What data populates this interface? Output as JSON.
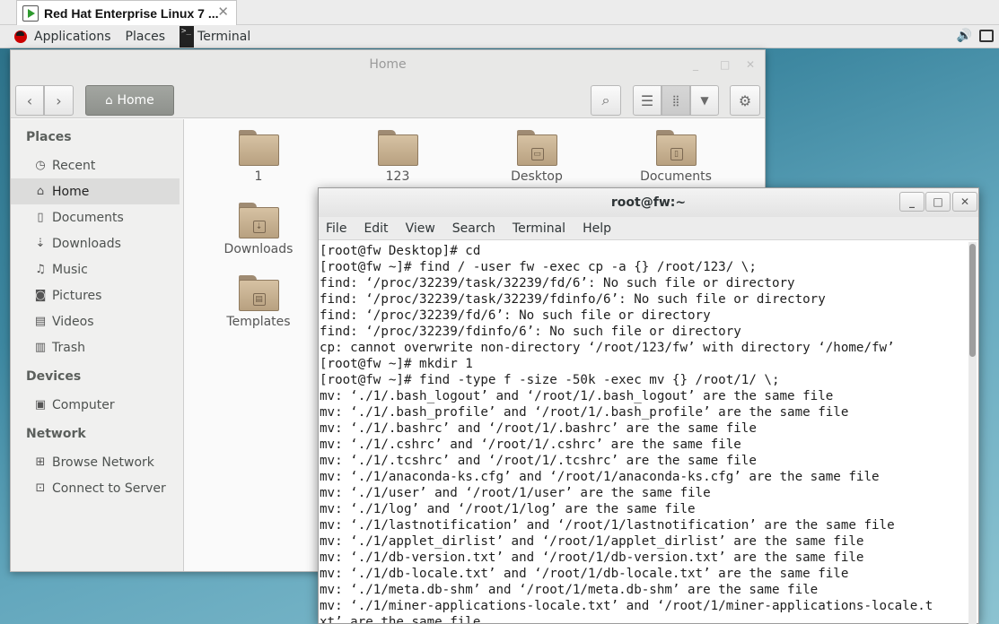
{
  "vm_tab": {
    "title": "Red Hat Enterprise Linux 7 ...",
    "close": "✕"
  },
  "topbar": {
    "applications": "Applications",
    "places": "Places",
    "terminal": "Terminal"
  },
  "files": {
    "title": "Home",
    "location": "Home",
    "sidebar": {
      "places_heading": "Places",
      "places": [
        {
          "label": "Recent",
          "icon": "clock-icon"
        },
        {
          "label": "Home",
          "icon": "home-icon"
        },
        {
          "label": "Documents",
          "icon": "document-icon"
        },
        {
          "label": "Downloads",
          "icon": "download-icon"
        },
        {
          "label": "Music",
          "icon": "music-icon"
        },
        {
          "label": "Pictures",
          "icon": "camera-icon"
        },
        {
          "label": "Videos",
          "icon": "film-icon"
        },
        {
          "label": "Trash",
          "icon": "trash-icon"
        }
      ],
      "devices_heading": "Devices",
      "devices": [
        {
          "label": "Computer",
          "icon": "drive-icon"
        }
      ],
      "network_heading": "Network",
      "network": [
        {
          "label": "Browse Network",
          "icon": "network-icon"
        },
        {
          "label": "Connect to Server",
          "icon": "server-icon"
        }
      ]
    },
    "items": [
      "1",
      "123",
      "Desktop",
      "Documents",
      "Downloads",
      "Templates"
    ]
  },
  "terminal": {
    "title": "root@fw:~",
    "menu": [
      "File",
      "Edit",
      "View",
      "Search",
      "Terminal",
      "Help"
    ],
    "lines": [
      "[root@fw Desktop]# cd",
      "[root@fw ~]# find / -user fw -exec cp -a {} /root/123/ \\;",
      "find: ‘/proc/32239/task/32239/fd/6’: No such file or directory",
      "find: ‘/proc/32239/task/32239/fdinfo/6’: No such file or directory",
      "find: ‘/proc/32239/fd/6’: No such file or directory",
      "find: ‘/proc/32239/fdinfo/6’: No such file or directory",
      "cp: cannot overwrite non-directory ‘/root/123/fw’ with directory ‘/home/fw’",
      "[root@fw ~]# mkdir 1",
      "[root@fw ~]# find -type f -size -50k -exec mv {} /root/1/ \\;",
      "mv: ‘./1/.bash_logout’ and ‘/root/1/.bash_logout’ are the same file",
      "mv: ‘./1/.bash_profile’ and ‘/root/1/.bash_profile’ are the same file",
      "mv: ‘./1/.bashrc’ and ‘/root/1/.bashrc’ are the same file",
      "mv: ‘./1/.cshrc’ and ‘/root/1/.cshrc’ are the same file",
      "mv: ‘./1/.tcshrc’ and ‘/root/1/.tcshrc’ are the same file",
      "mv: ‘./1/anaconda-ks.cfg’ and ‘/root/1/anaconda-ks.cfg’ are the same file",
      "mv: ‘./1/user’ and ‘/root/1/user’ are the same file",
      "mv: ‘./1/log’ and ‘/root/1/log’ are the same file",
      "mv: ‘./1/lastnotification’ and ‘/root/1/lastnotification’ are the same file",
      "mv: ‘./1/applet_dirlist’ and ‘/root/1/applet_dirlist’ are the same file",
      "mv: ‘./1/db-version.txt’ and ‘/root/1/db-version.txt’ are the same file",
      "mv: ‘./1/db-locale.txt’ and ‘/root/1/db-locale.txt’ are the same file",
      "mv: ‘./1/meta.db-shm’ and ‘/root/1/meta.db-shm’ are the same file",
      "mv: ‘./1/miner-applications-locale.txt’ and ‘/root/1/miner-applications-locale.t",
      "xt’ are the same file"
    ],
    "scroll_fraction": 0.3
  }
}
